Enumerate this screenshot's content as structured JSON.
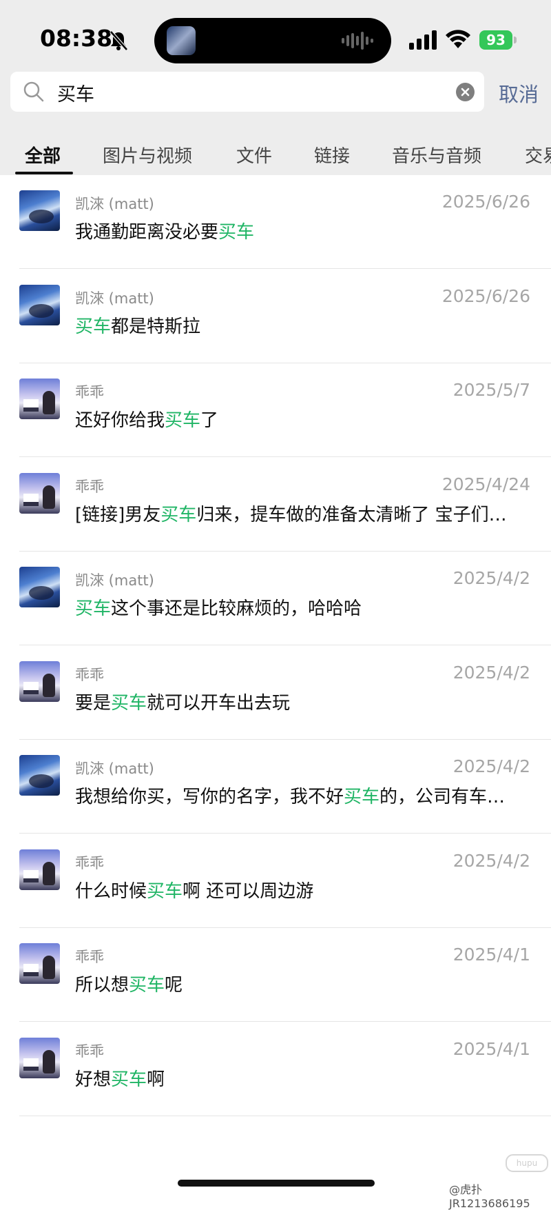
{
  "status_bar": {
    "time": "08:38",
    "battery": "93"
  },
  "search": {
    "query": "买车",
    "cancel_label": "取消"
  },
  "tabs": [
    {
      "label": "全部",
      "active": true
    },
    {
      "label": "图片与视频",
      "active": false
    },
    {
      "label": "文件",
      "active": false
    },
    {
      "label": "链接",
      "active": false
    },
    {
      "label": "音乐与音频",
      "active": false
    },
    {
      "label": "交易",
      "active": false
    }
  ],
  "results": [
    {
      "sender": "凯淶 (matt)",
      "avatar": "matt",
      "date": "2025/6/26",
      "before": "我通勤距离没必要",
      "keyword": "买车",
      "after": ""
    },
    {
      "sender": "凯淶 (matt)",
      "avatar": "matt",
      "date": "2025/6/26",
      "before": "",
      "keyword": "买车",
      "after": "都是特斯拉"
    },
    {
      "sender": "乖乖",
      "avatar": "guai",
      "date": "2025/5/7",
      "before": "还好你给我",
      "keyword": "买车",
      "after": "了"
    },
    {
      "sender": "乖乖",
      "avatar": "guai",
      "date": "2025/4/24",
      "before": "[链接]男友",
      "keyword": "买车",
      "after": "归来，提车做的准备太清晰了 宝子们…"
    },
    {
      "sender": "凯淶 (matt)",
      "avatar": "matt",
      "date": "2025/4/2",
      "before": "",
      "keyword": "买车",
      "after": "这个事还是比较麻烦的，哈哈哈"
    },
    {
      "sender": "乖乖",
      "avatar": "guai",
      "date": "2025/4/2",
      "before": "要是",
      "keyword": "买车",
      "after": "就可以开车出去玩"
    },
    {
      "sender": "凯淶 (matt)",
      "avatar": "matt",
      "date": "2025/4/2",
      "before": "我想给你买，写你的名字，我不好",
      "keyword": "买车",
      "after": "的，公司有车…"
    },
    {
      "sender": "乖乖",
      "avatar": "guai",
      "date": "2025/4/2",
      "before": "什么时候",
      "keyword": "买车",
      "after": "啊 还可以周边游"
    },
    {
      "sender": "乖乖",
      "avatar": "guai",
      "date": "2025/4/1",
      "before": "所以想",
      "keyword": "买车",
      "after": "呢"
    },
    {
      "sender": "乖乖",
      "avatar": "guai",
      "date": "2025/4/1",
      "before": "好想",
      "keyword": "买车",
      "after": "啊"
    }
  ],
  "watermark": "@虎扑JR1213686195",
  "colors": {
    "highlight": "#20b565",
    "cancel": "#576b95",
    "battery": "#34c759"
  }
}
